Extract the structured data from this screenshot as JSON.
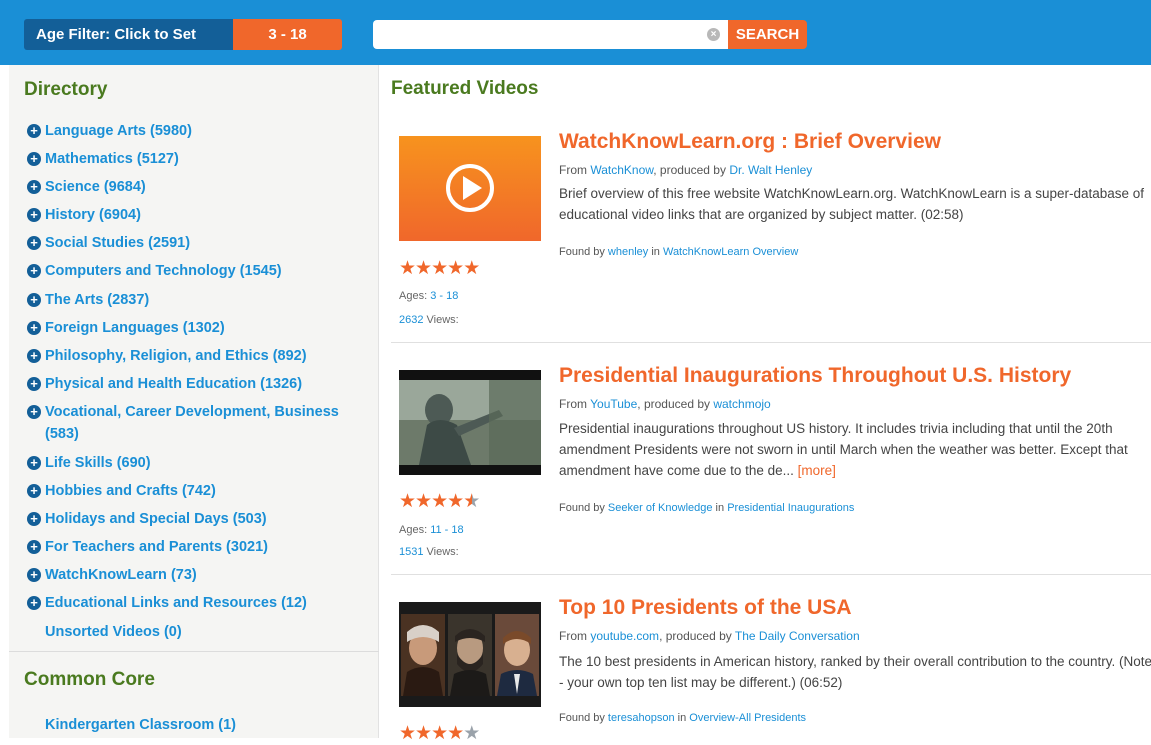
{
  "topbar": {
    "age_filter_label": "Age Filter: Click to Set",
    "age_filter_value": "3 - 18",
    "search_placeholder": "",
    "search_button": "SEARCH"
  },
  "sidebar": {
    "directory_title": "Directory",
    "items": [
      {
        "label": "Language Arts (5980)"
      },
      {
        "label": "Mathematics (5127)"
      },
      {
        "label": "Science (9684)"
      },
      {
        "label": "History (6904)"
      },
      {
        "label": "Social Studies (2591)"
      },
      {
        "label": "Computers and Technology (1545)"
      },
      {
        "label": "The Arts (2837)"
      },
      {
        "label": "Foreign Languages (1302)"
      },
      {
        "label": "Philosophy, Religion, and Ethics (892)"
      },
      {
        "label": "Physical and Health Education (1326)"
      },
      {
        "label": "Vocational, Career Development, Business (583)"
      },
      {
        "label": "Life Skills (690)"
      },
      {
        "label": "Hobbies and Crafts (742)"
      },
      {
        "label": "Holidays and Special Days (503)"
      },
      {
        "label": "For Teachers and Parents (3021)"
      },
      {
        "label": "WatchKnowLearn (73)"
      },
      {
        "label": "Educational Links and Resources (12)"
      },
      {
        "label": "Unsorted Videos (0)"
      }
    ],
    "common_core_title": "Common Core",
    "common_core_items": [
      {
        "label": "Kindergarten Classroom (1)"
      }
    ]
  },
  "main": {
    "heading": "Featured Videos",
    "videos": [
      {
        "title": "WatchKnowLearn.org : Brief Overview",
        "from_prefix": "From ",
        "source": "WatchKnow",
        "produced_by_prefix": ", produced by ",
        "producer": "Dr. Walt Henley",
        "desc_line1": "Brief overview of this free website WatchKnowLearn.org.  WatchKnowLearn is a super-database of",
        "desc_line2": "educational video links that are organized by subject matter. (02:58)",
        "desc_line3": "",
        "more": "",
        "found_prefix": "Found by ",
        "found_by": "whenley",
        "found_in_prefix": " in ",
        "found_in": "WatchKnowLearn Overview",
        "rating": 5,
        "ages_prefix": "Ages: ",
        "ages": "3 - 18",
        "views": "2632",
        "views_suffix": " Views:"
      },
      {
        "title": "Presidential Inaugurations Throughout U.S. History",
        "from_prefix": "From ",
        "source": "YouTube",
        "produced_by_prefix": ", produced by ",
        "producer": "watchmojo",
        "desc_line1": "Presidential inaugurations throughout US history. It includes trivia including that until the 20th",
        "desc_line2": "amendment Presidents were not sworn in until March when the weather was better. Except that",
        "desc_line3": "amendment have come due to the de...",
        "more": "[more]",
        "found_prefix": "Found by ",
        "found_by": "Seeker of Knowledge",
        "found_in_prefix": " in ",
        "found_in": "Presidential Inaugurations",
        "rating": 4.5,
        "ages_prefix": "Ages: ",
        "ages": "11 - 18",
        "views": "1531",
        "views_suffix": " Views:"
      },
      {
        "title": "Top 10 Presidents of the USA",
        "from_prefix": "From ",
        "source": "youtube.com",
        "produced_by_prefix": ", produced by ",
        "producer": "The Daily Conversation",
        "desc_line1": "The 10 best presidents in American history, ranked by their overall contribution to the country. (Note",
        "desc_line2": "- your own top ten list may be different.) (06:52)",
        "desc_line3": "",
        "more": "",
        "found_prefix": "Found by ",
        "found_by": "teresahopson",
        "found_in_prefix": " in ",
        "found_in": "Overview-All Presidents",
        "rating": 4,
        "ages_prefix": "",
        "ages": "",
        "views": "",
        "views_suffix": ""
      }
    ]
  },
  "icons": {
    "expand": "plus-circle-icon",
    "play": "play-circle-icon",
    "clear": "clear-x-icon",
    "star": "star-icon"
  },
  "colors": {
    "topbar": "#1a8fd6",
    "accent_orange": "#f0672b",
    "heading_green": "#4a7a1f",
    "link_blue": "#1a8fd6"
  }
}
